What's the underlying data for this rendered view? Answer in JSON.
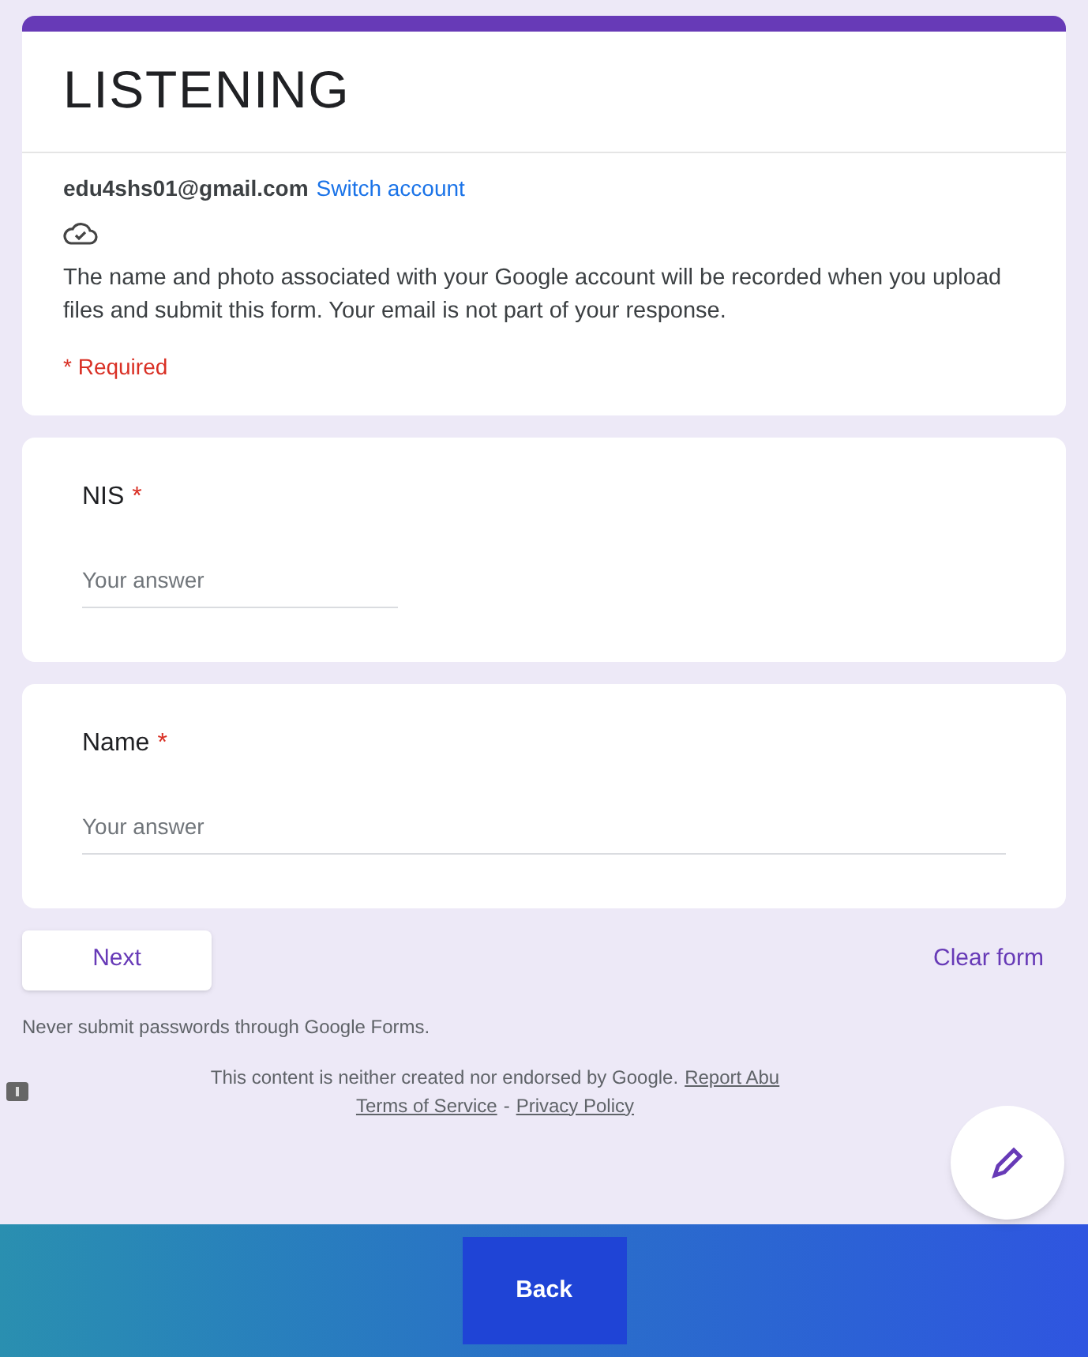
{
  "header": {
    "title": "LISTENING",
    "email": "edu4shs01@gmail.com",
    "switch_link": "Switch account",
    "notice": "The name and photo associated with your Google account will be recorded when you upload files and submit this form. Your email is not part of your response.",
    "required_note": "* Required"
  },
  "questions": [
    {
      "label": "NIS",
      "required_mark": "*",
      "placeholder": "Your answer",
      "kind": "short"
    },
    {
      "label": "Name",
      "required_mark": "*",
      "placeholder": "Your answer",
      "kind": "long"
    }
  ],
  "next_button": "Next",
  "clear_button": "Clear form",
  "password_warning": "Never submit passwords through Google Forms.",
  "footer": {
    "disclaimer": "This content is neither created nor endorsed by Google.",
    "report_link": "Report Abu",
    "terms_link": "Terms of Service",
    "separator": "-",
    "privacy_link": "Privacy Policy"
  },
  "back_button": "Back"
}
